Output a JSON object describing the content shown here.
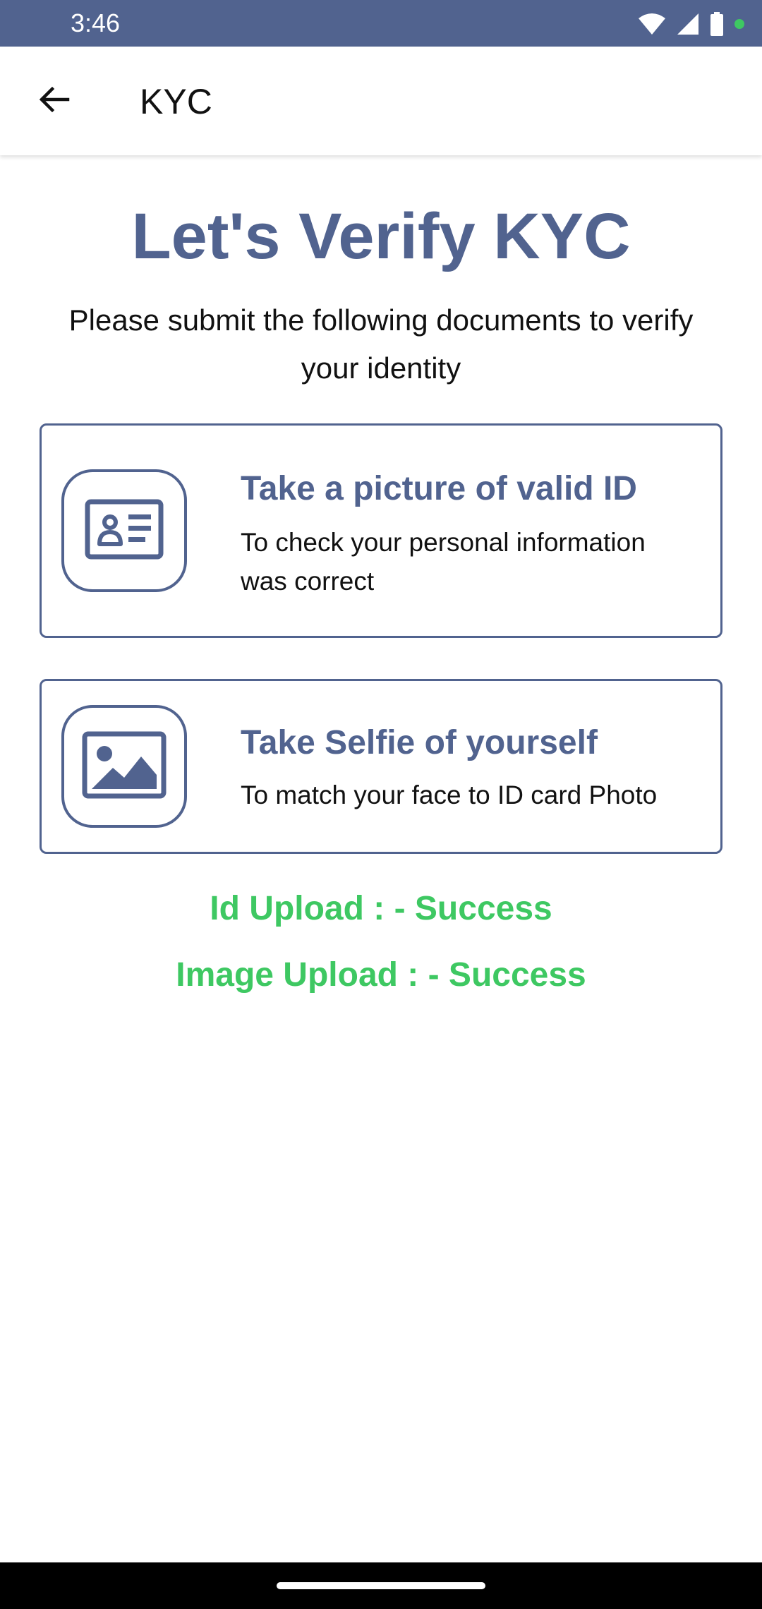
{
  "status_bar": {
    "time": "3:46",
    "icons": [
      "wifi-icon",
      "signal-icon",
      "battery-icon",
      "notification-dot-icon"
    ],
    "background_color": "#51638f",
    "dot_color": "#3ec862"
  },
  "app_bar": {
    "back_icon": "arrow-left-icon",
    "title": "KYC"
  },
  "main": {
    "heading": "Let's Verify KYC",
    "subtitle": "Please submit the following documents to verify your identity",
    "cards": [
      {
        "icon": "id-card-icon",
        "title": "Take a picture of valid ID",
        "description": "To check your personal information was correct"
      },
      {
        "icon": "image-icon",
        "title": "Take Selfie of yourself",
        "description": "To match your face to ID card Photo"
      }
    ],
    "id_upload_status": "Id Upload : - Success",
    "image_upload_status": "Image Upload : - Success"
  },
  "colors": {
    "accent": "#51638f",
    "success": "#3ec862",
    "text": "#111111"
  }
}
